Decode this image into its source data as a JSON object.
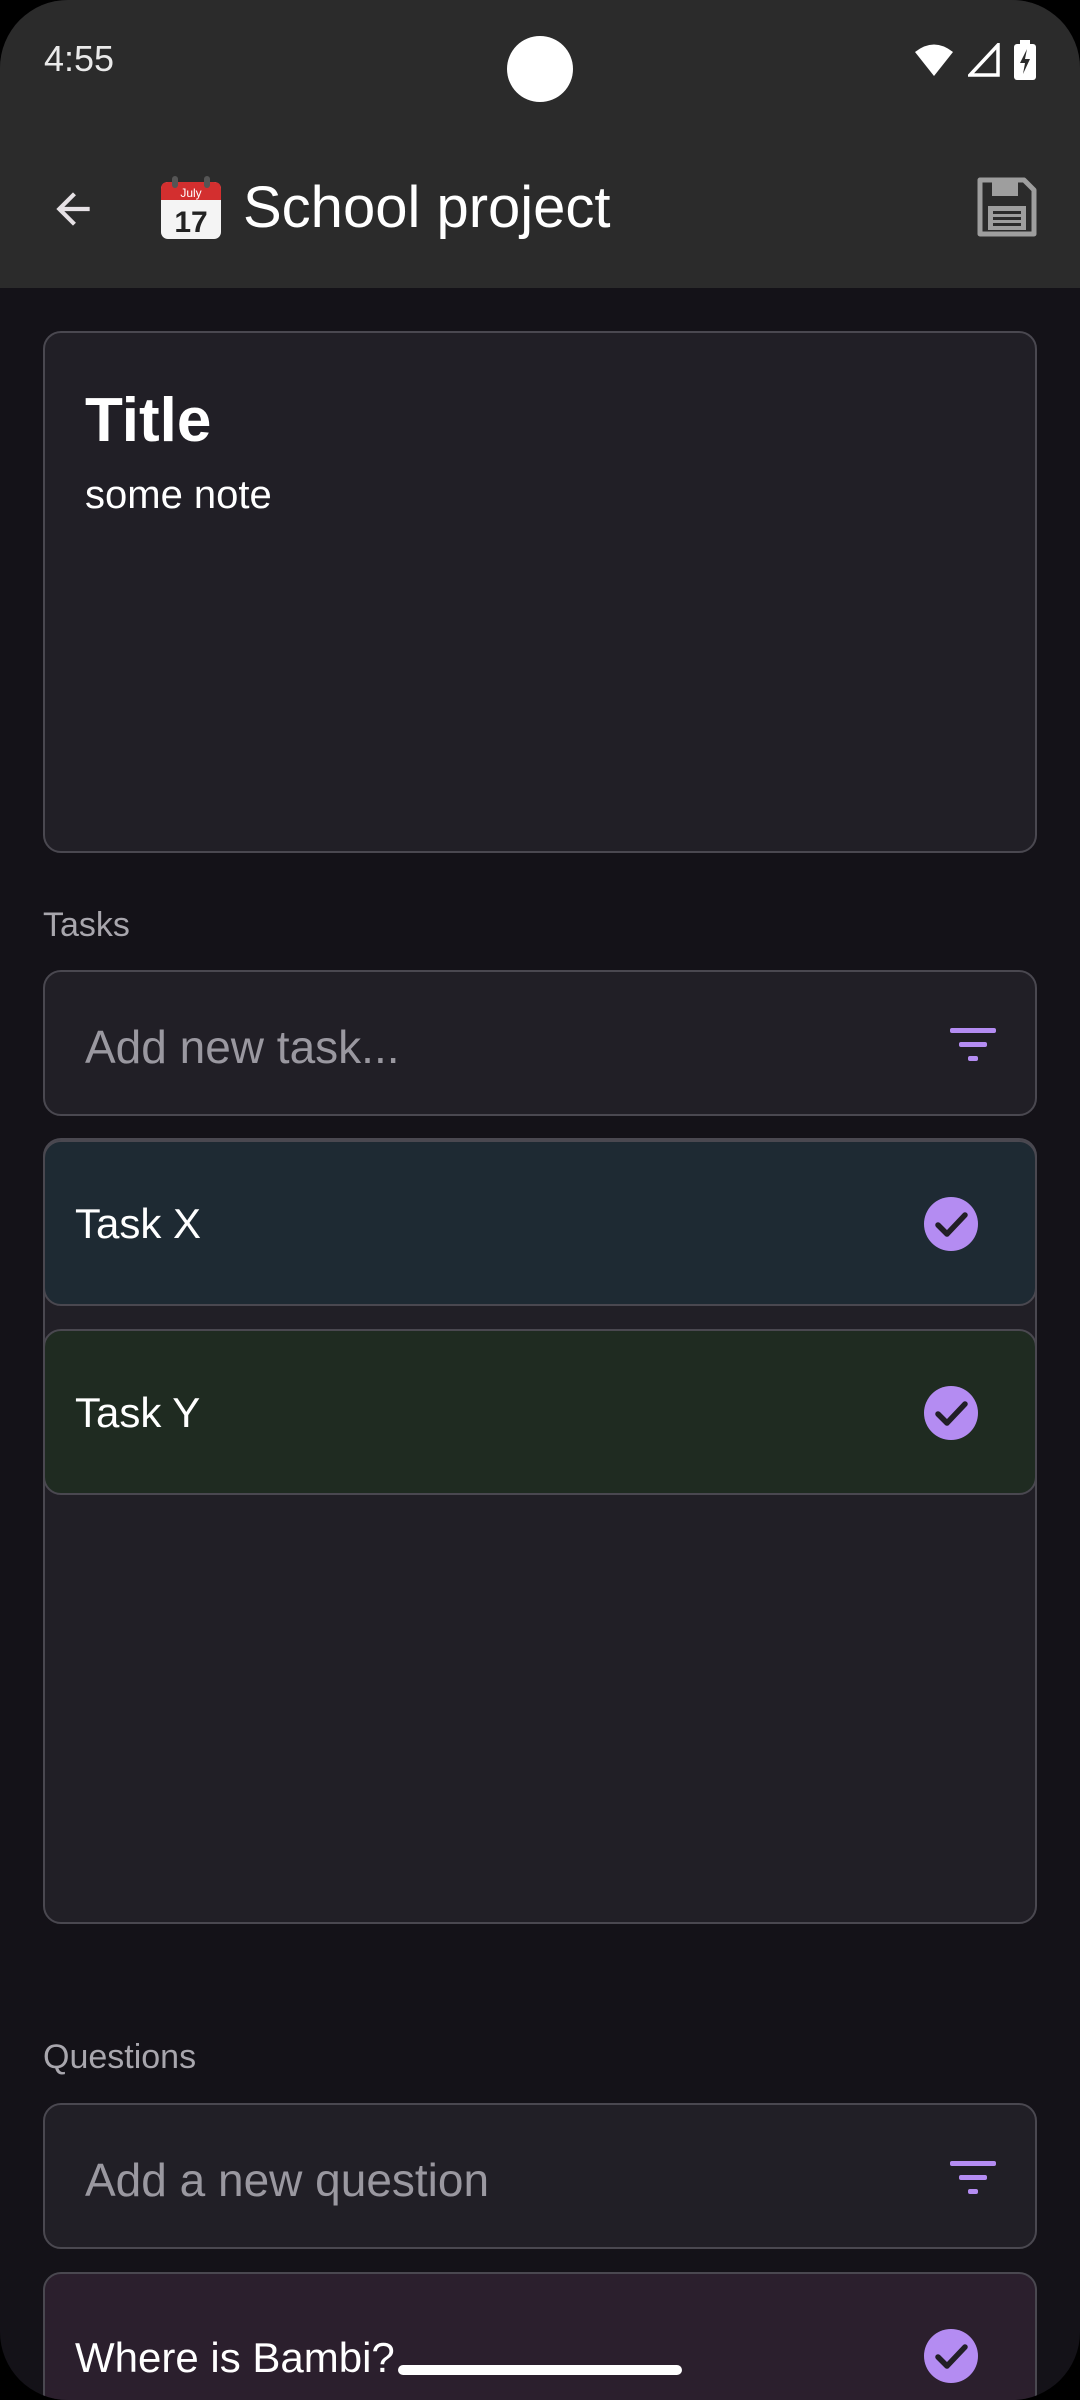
{
  "status_bar": {
    "time": "4:55"
  },
  "app_bar": {
    "title": "School project",
    "calendar_month": "July",
    "calendar_day": "17"
  },
  "note": {
    "title": "Title",
    "body": "some note"
  },
  "tasks": {
    "section_label": "Tasks",
    "input_placeholder": "Add new task...",
    "items": [
      {
        "label": "Task X",
        "color": "#1e2a33"
      },
      {
        "label": "Task Y",
        "color": "#1f2b21"
      }
    ]
  },
  "questions": {
    "section_label": "Questions",
    "input_placeholder": "Add a new question",
    "items": [
      {
        "label": "Where is Bambi?",
        "color": "#2b1f2d"
      }
    ]
  },
  "colors": {
    "accent": "#b48cf2",
    "surface": "#211f26",
    "background": "#141218"
  }
}
